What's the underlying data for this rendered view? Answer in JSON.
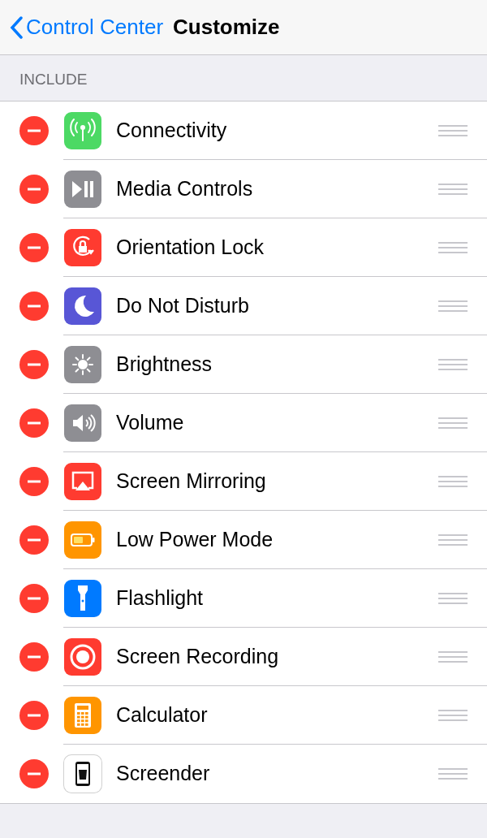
{
  "nav": {
    "back": "Control Center",
    "title": "Customize"
  },
  "section": "INCLUDE",
  "items": [
    {
      "label": "Connectivity",
      "kind": "antenna",
      "color": "#4cd964"
    },
    {
      "label": "Media Controls",
      "kind": "playpause",
      "color": "#8e8e93"
    },
    {
      "label": "Orientation Lock",
      "kind": "rotation-lock",
      "color": "#ff3b30"
    },
    {
      "label": "Do Not Disturb",
      "kind": "moon",
      "color": "#5856d6"
    },
    {
      "label": "Brightness",
      "kind": "sun",
      "color": "#8e8e93"
    },
    {
      "label": "Volume",
      "kind": "speaker",
      "color": "#8e8e93"
    },
    {
      "label": "Screen Mirroring",
      "kind": "airplay",
      "color": "#ff3b30"
    },
    {
      "label": "Low Power Mode",
      "kind": "battery",
      "color": "#ff9500"
    },
    {
      "label": "Flashlight",
      "kind": "flashlight",
      "color": "#007aff"
    },
    {
      "label": "Screen Recording",
      "kind": "record",
      "color": "#ff3b30"
    },
    {
      "label": "Calculator",
      "kind": "calculator",
      "color": "#ff9500"
    },
    {
      "label": "Screender",
      "kind": "phone",
      "color": "#ffffff"
    }
  ]
}
